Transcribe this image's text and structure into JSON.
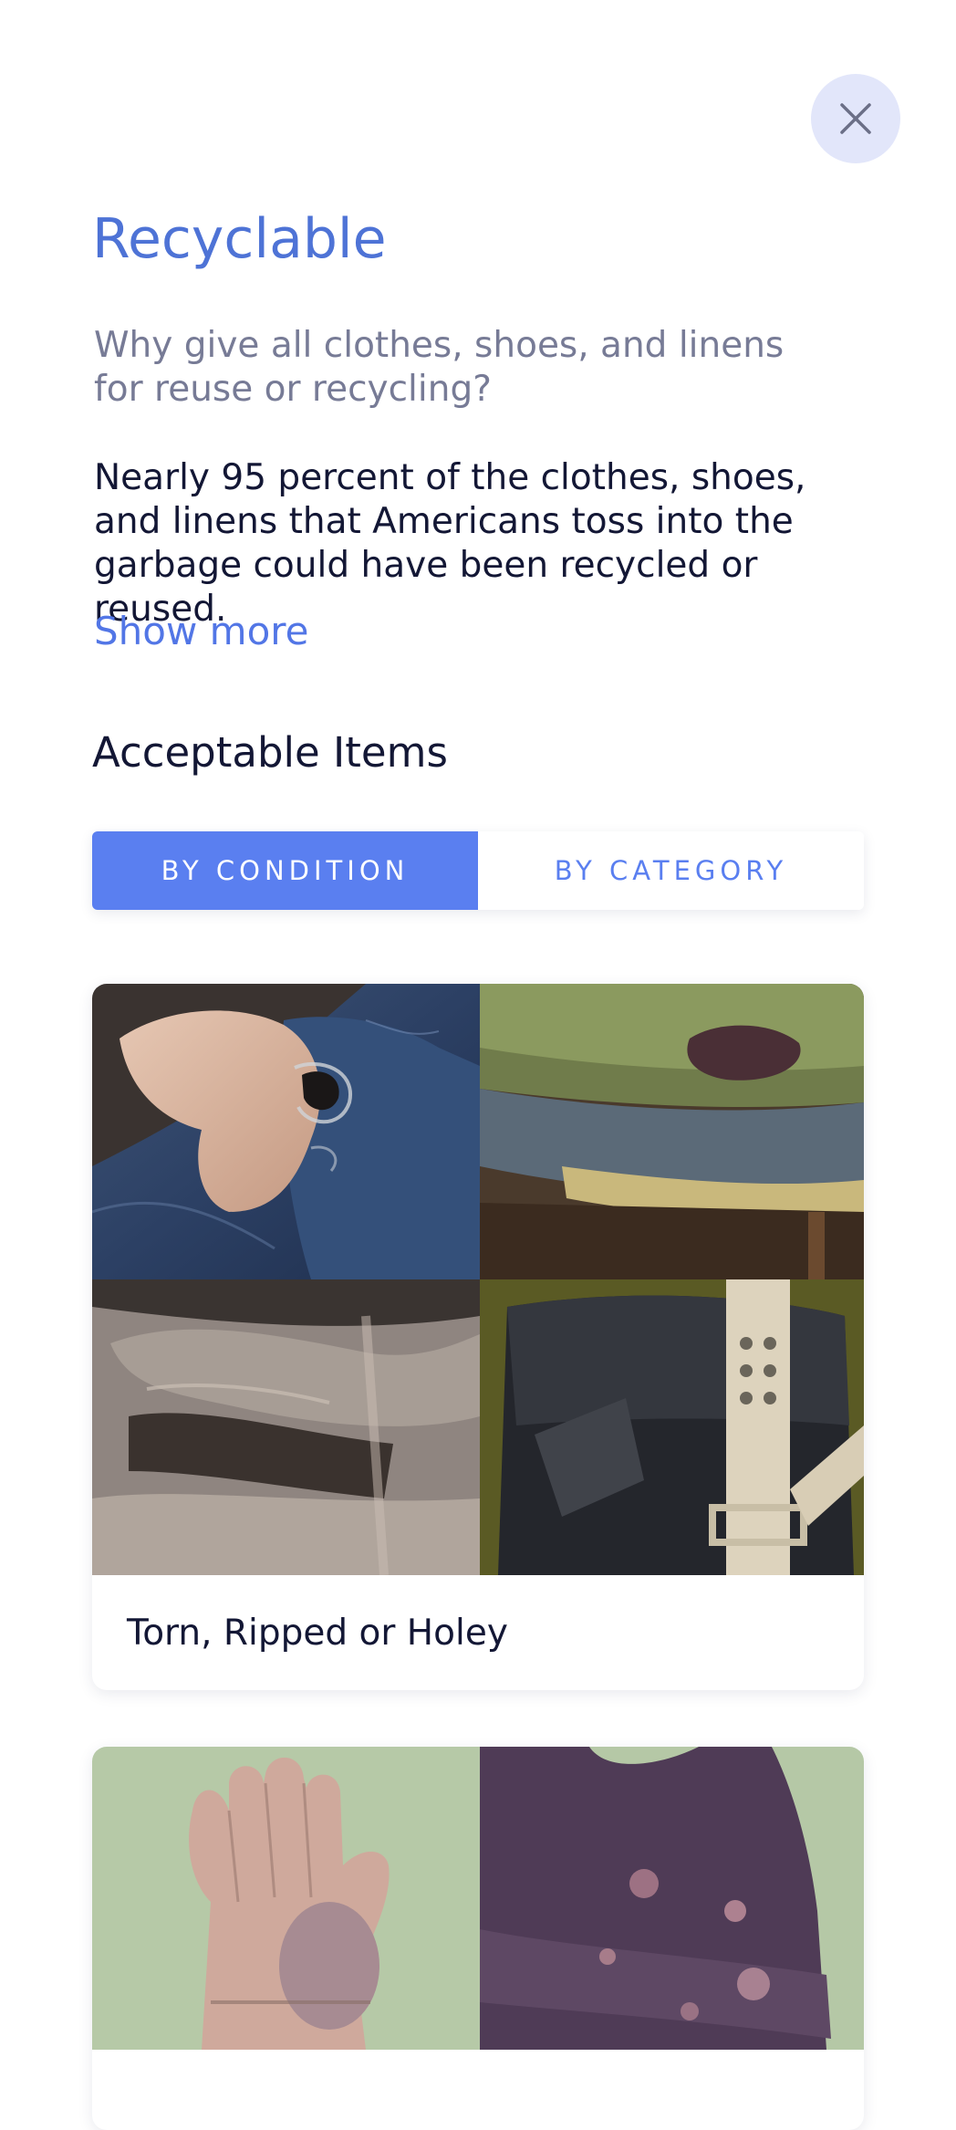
{
  "modal": {
    "close_label": "Close"
  },
  "header": {
    "title": "Recyclable",
    "subtitle": "Why give all clothes, shoes, and linens for reuse or recycling?",
    "body": "Nearly 95 percent of the clothes, shoes, and linens that Americans toss into the garbage could have been recycled or reused.",
    "show_more": "Show more"
  },
  "section": {
    "heading": "Acceptable Items",
    "tabs": [
      {
        "label": "BY CONDITION",
        "active": true
      },
      {
        "label": "BY CATEGORY",
        "active": false
      }
    ]
  },
  "cards": [
    {
      "label": "Torn, Ripped or Holey",
      "photos": [
        "ripped-denim",
        "worn-upholstered-stool",
        "frayed-towel",
        "worn-leather-bag-with-belt"
      ]
    },
    {
      "label": "",
      "photos": [
        "worn-glove",
        "stained-sleeve"
      ]
    }
  ],
  "colors": {
    "accent": "#5a7ff0",
    "title": "#4e73d6",
    "close_bg": "#e2e6fa",
    "text_dark": "#131735",
    "text_muted": "#777b96"
  }
}
